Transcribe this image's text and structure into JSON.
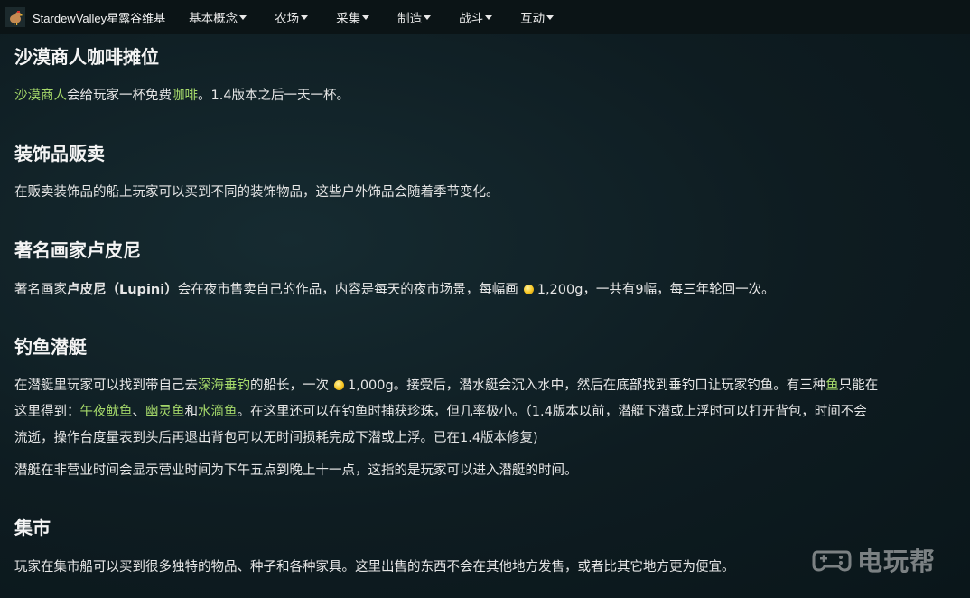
{
  "navbar": {
    "site_title": "StardewValley星露谷维基",
    "items": [
      {
        "label": "基本概念"
      },
      {
        "label": "农场"
      },
      {
        "label": "采集"
      },
      {
        "label": "制造"
      },
      {
        "label": "战斗"
      },
      {
        "label": "互动"
      }
    ]
  },
  "sections": {
    "coffee": {
      "title": "沙漠商人咖啡摊位",
      "link1": "沙漠商人",
      "text1": "会给玩家一杯免费",
      "link2": "咖啡",
      "text2": "。1.4版本之后一天一杯。"
    },
    "decor": {
      "title": "装饰品贩卖",
      "text": "在贩卖装饰品的船上玩家可以买到不同的装饰物品，这些户外饰品会随着季节变化。"
    },
    "painter": {
      "title": "著名画家卢皮尼",
      "text1": "著名画家",
      "bold": "卢皮尼（Lupini）",
      "text2": "会在夜市售卖自己的作品，内容是每天的夜市场景，每幅画",
      "price": "1,200g",
      "text3": "，一共有9幅，每三年轮回一次。"
    },
    "submarine": {
      "title": "钓鱼潜艇",
      "p1_text1": "在潜艇里玩家可以找到带自己去",
      "p1_link1": "深海垂钓",
      "p1_text2": "的船长，一次",
      "p1_price": "1,000g",
      "p1_text3": "。接受后，潜水艇会沉入水中，然后在底部找到垂钓口让玩家钓鱼。有三种",
      "p1_link2": "鱼",
      "p1_text4": "只能在",
      "p2_text1": "这里得到：",
      "p2_link1": "午夜鱿鱼",
      "p2_sep1": "、",
      "p2_link2": "幽灵鱼",
      "p2_sep2": "和",
      "p2_link3": "水滴鱼",
      "p2_text2": "。在这里还可以在钓鱼时捕获珍珠，但几率极小。（1.4版本以前，潜艇下潜或上浮时可以打开背包，时间不会",
      "p3_text": "流逝，操作台度量表到头后再退出背包可以无时间损耗完成下潜或上浮。已在1.4版本修复)",
      "p4_text": "潜艇在非营业时间会显示营业时间为下午五点到晚上十一点，这指的是玩家可以进入潜艇的时间。"
    },
    "market": {
      "title": "集市",
      "text": "玩家在集市船可以买到很多独特的物品、种子和各种家具。这里出售的东西不会在其他地方发售，或者比其它地方更为便宜。"
    }
  },
  "watermark": {
    "text": "电玩帮"
  },
  "colors": {
    "link": "#a5d96a",
    "background": "#0f1f24",
    "navbar": "#0b1416"
  }
}
